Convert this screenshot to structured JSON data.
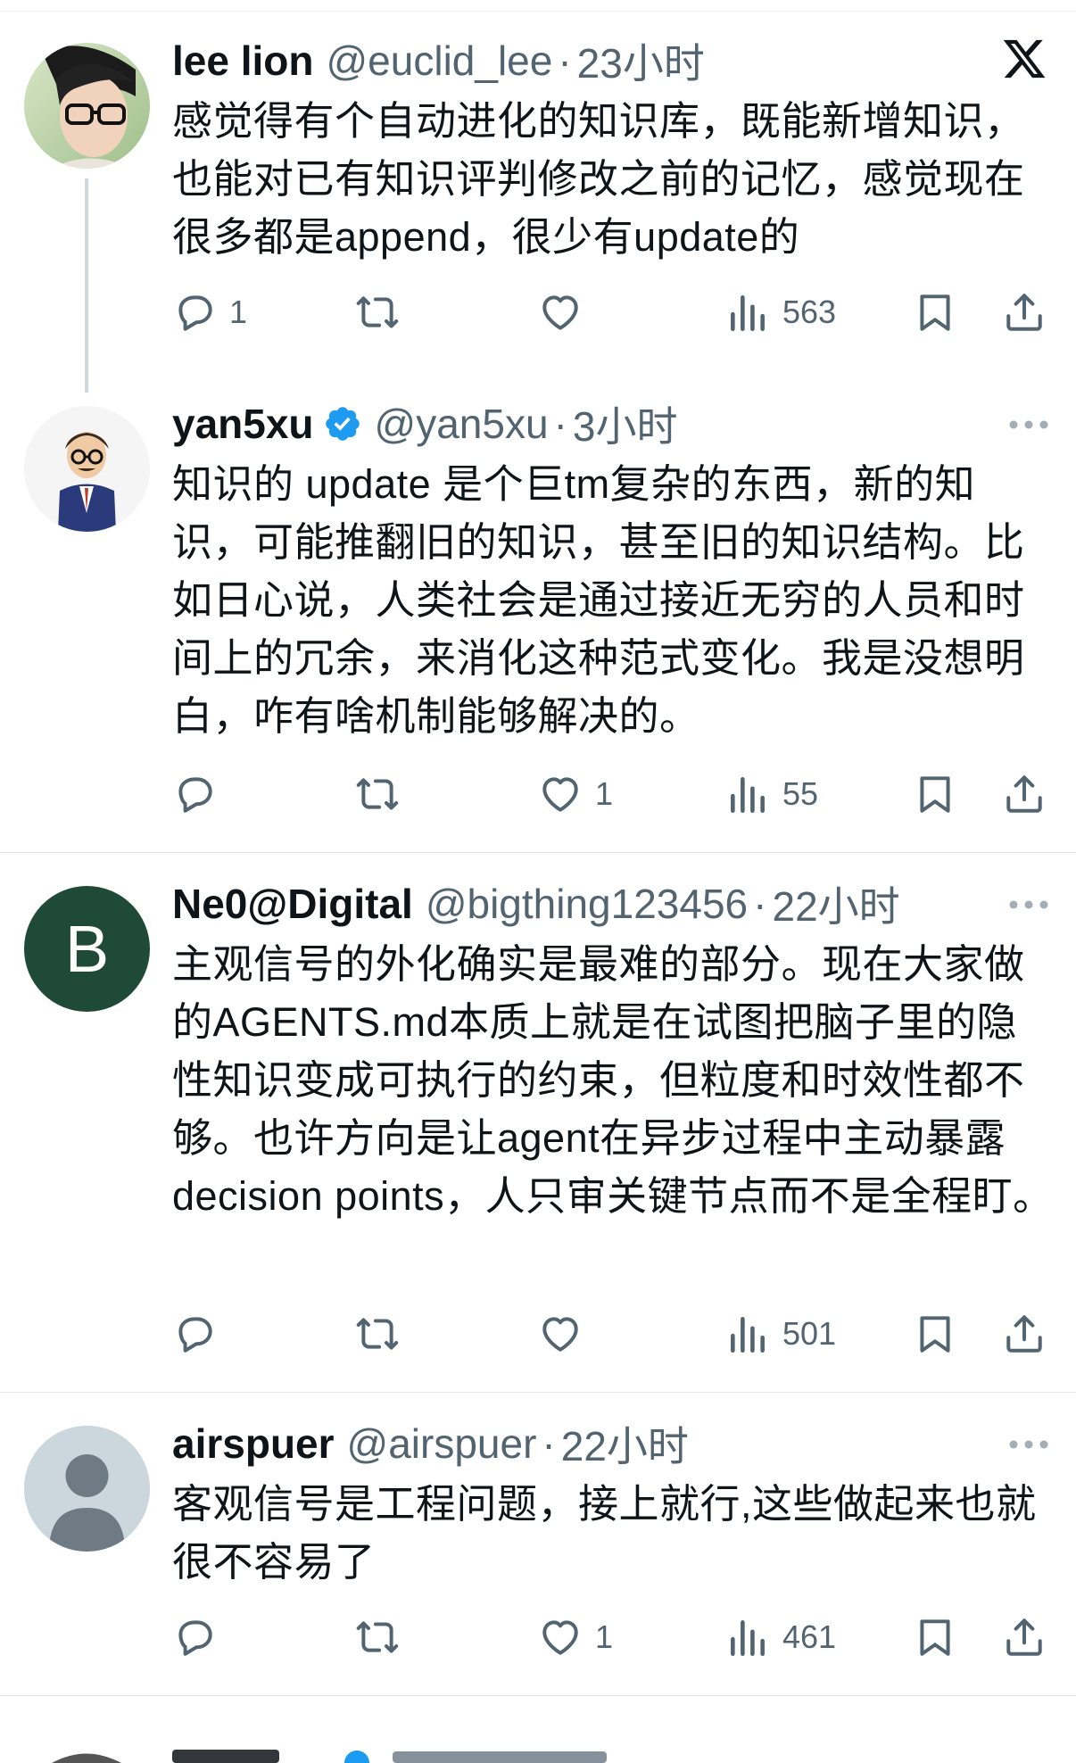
{
  "tweets": [
    {
      "name": "lee lion",
      "handle": "@euclid_lee",
      "dot": "·",
      "time": "23小时",
      "text": "感觉得有个自动进化的知识库，既能新增知识，也能对已有知识评判修改之前的记忆，感觉现在很多都是append，很少有update的",
      "replies": "1",
      "retweets": "",
      "likes": "",
      "views": "563"
    },
    {
      "name": "yan5xu",
      "handle": "@yan5xu",
      "dot": "·",
      "time": "3小时",
      "text": "知识的 update 是个巨tm复杂的东西，新的知识，可能推翻旧的知识，甚至旧的知识结构。比如日心说，人类社会是通过接近无穷的人员和时间上的冗余，来消化这种范式变化。我是没想明白，咋有啥机制能够解决的。",
      "replies": "",
      "retweets": "",
      "likes": "1",
      "views": "55"
    },
    {
      "name": "Ne0@Digital",
      "handle": "@bigthing123456",
      "dot": "·",
      "time": "22小时",
      "avatar_letter": "B",
      "text": "主观信号的外化确实是最难的部分。现在大家做的AGENTS.md本质上就是在试图把脑子里的隐性知识变成可执行的约束，但粒度和时效性都不够。也许方向是让agent在异步过程中主动暴露decision points，人只审关键节点而不是全程盯。",
      "replies": "",
      "retweets": "",
      "likes": "",
      "views": "501"
    },
    {
      "name": "airspuer",
      "handle": "@airspuer",
      "dot": "·",
      "time": "22小时",
      "text": "客观信号是工程问题，接上就行,这些做起来也就很不容易了",
      "replies": "",
      "retweets": "",
      "likes": "1",
      "views": "461"
    }
  ],
  "colors": {
    "text": "#0f1419",
    "secondary": "#536471",
    "verified": "#1d9bf0",
    "neo_avatar_bg": "#1f4a3a",
    "separator": "#e3e7ea",
    "thread_line": "#cfd9de"
  },
  "icons": {
    "platform": "x-logo-icon",
    "reply": "reply-icon",
    "retweet": "retweet-icon",
    "like": "heart-icon",
    "views": "views-chart-icon",
    "bookmark": "bookmark-icon",
    "share": "share-icon",
    "more": "more-dots-icon",
    "verified": "verified-badge-icon"
  }
}
